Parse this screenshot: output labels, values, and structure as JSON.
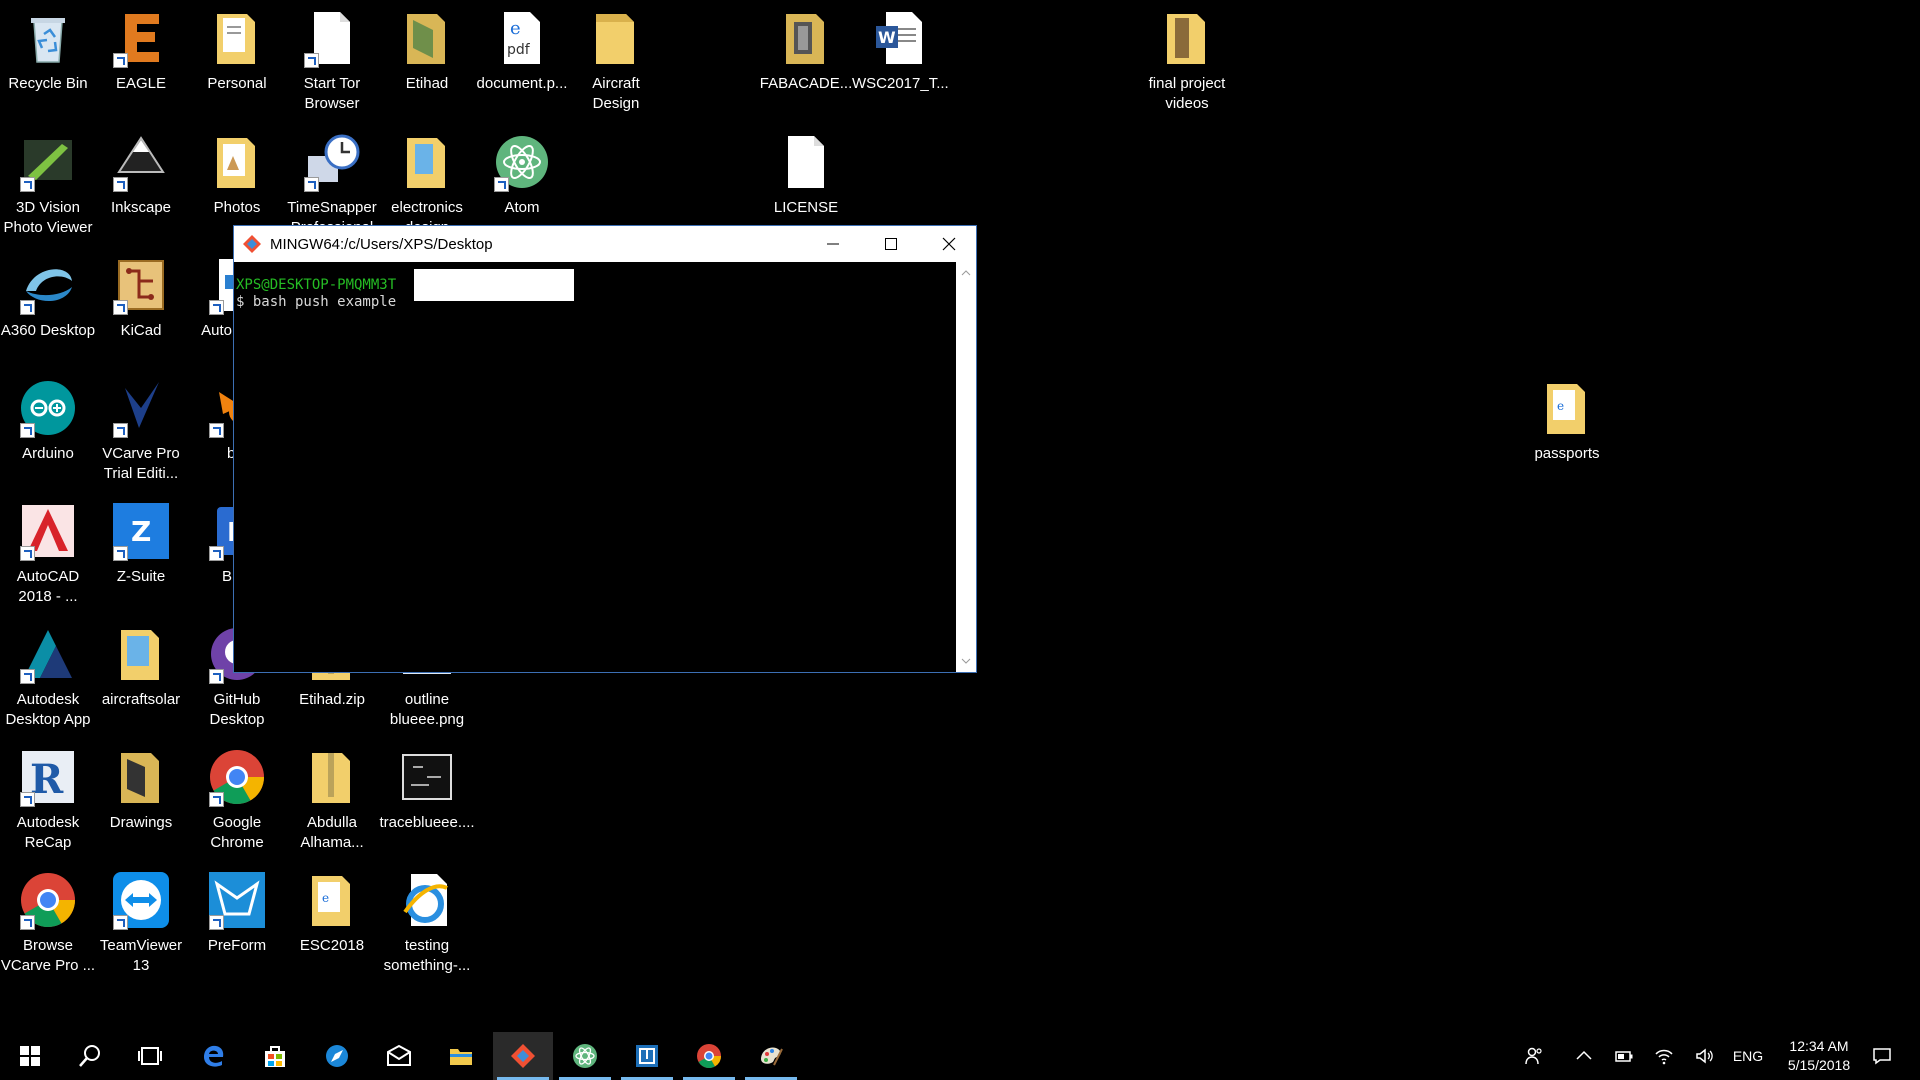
{
  "desktop": {
    "icons": [
      {
        "label": "Recycle Bin",
        "icon": "recycle-bin-icon"
      },
      {
        "label": "EAGLE",
        "icon": "eagle-icon"
      },
      {
        "label": "Personal",
        "icon": "folder-icon"
      },
      {
        "label": "Start Tor Browser",
        "icon": "file-icon"
      },
      {
        "label": "Etihad",
        "icon": "folder-icon"
      },
      {
        "label": "document.p...",
        "icon": "pdf-icon"
      },
      {
        "label": "Aircraft Design",
        "icon": "folder-icon"
      },
      {
        "label": "FABACADE...",
        "icon": "folder-icon"
      },
      {
        "label": "WSC2017_T...",
        "icon": "word-doc-icon"
      },
      {
        "label": "final project videos",
        "icon": "folder-icon"
      },
      {
        "label": "3D Vision Photo Viewer",
        "icon": "3d-vision-icon"
      },
      {
        "label": "Inkscape",
        "icon": "inkscape-icon"
      },
      {
        "label": "Photos",
        "icon": "folder-icon"
      },
      {
        "label": "TimeSnapper Professional",
        "icon": "timesnapper-icon"
      },
      {
        "label": "electronics design",
        "icon": "folder-icon"
      },
      {
        "label": "Atom",
        "icon": "atom-icon"
      },
      {
        "label": "LICENSE",
        "icon": "file-icon"
      },
      {
        "label": "A360 Desktop",
        "icon": "a360-icon"
      },
      {
        "label": "KiCad",
        "icon": "kicad-icon"
      },
      {
        "label": "Auto Fusio",
        "icon": "fusion-icon"
      },
      {
        "label": "Arduino",
        "icon": "arduino-icon"
      },
      {
        "label": "VCarve Pro Trial Editi...",
        "icon": "vcarve-icon"
      },
      {
        "label": "ble",
        "icon": "blender-icon"
      },
      {
        "label": "passports",
        "icon": "folder-icon"
      },
      {
        "label": "AutoCAD 2018 - ...",
        "icon": "autocad-icon"
      },
      {
        "label": "Z-Suite",
        "icon": "zsuite-icon"
      },
      {
        "label": "Blue",
        "icon": "bluestacks-icon"
      },
      {
        "label": "Autodesk Desktop App",
        "icon": "autodesk-app-icon"
      },
      {
        "label": "aircraftsolar",
        "icon": "folder-icon"
      },
      {
        "label": "GitHub Desktop",
        "icon": "github-icon"
      },
      {
        "label": "Etihad.zip",
        "icon": "zip-folder-icon"
      },
      {
        "label": "outline blueee.png",
        "icon": "image-icon"
      },
      {
        "label": "Autodesk ReCap",
        "icon": "recap-icon"
      },
      {
        "label": "Drawings",
        "icon": "folder-icon"
      },
      {
        "label": "Google Chrome",
        "icon": "chrome-icon"
      },
      {
        "label": "Abdulla Alhama...",
        "icon": "zip-folder-icon"
      },
      {
        "label": "traceblueee....",
        "icon": "image-icon"
      },
      {
        "label": "Browse VCarve Pro ...",
        "icon": "chrome-icon"
      },
      {
        "label": "TeamViewer 13",
        "icon": "teamviewer-icon"
      },
      {
        "label": "PreForm",
        "icon": "preform-icon"
      },
      {
        "label": "ESC2018",
        "icon": "folder-icon"
      },
      {
        "label": "testing something-...",
        "icon": "ie-file-icon"
      }
    ]
  },
  "terminal": {
    "title": "MINGW64:/c/Users/XPS/Desktop",
    "prompt": "XPS@DESKTOP-PMQMM3T",
    "command": "$ bash push example"
  },
  "taskbar": {
    "apps": [
      {
        "name": "start-button",
        "icon": "windows-logo-icon"
      },
      {
        "name": "search-button",
        "icon": "search-icon"
      },
      {
        "name": "task-view-button",
        "icon": "task-view-icon"
      },
      {
        "name": "taskbar-edge",
        "icon": "edge-icon"
      },
      {
        "name": "taskbar-store",
        "icon": "store-icon"
      },
      {
        "name": "taskbar-app-blue",
        "icon": "compass-icon"
      },
      {
        "name": "taskbar-mail",
        "icon": "mail-icon"
      },
      {
        "name": "taskbar-file-explorer",
        "icon": "folder-icon"
      },
      {
        "name": "taskbar-git-bash",
        "icon": "git-icon"
      },
      {
        "name": "taskbar-atom",
        "icon": "atom-icon"
      },
      {
        "name": "taskbar-app-box",
        "icon": "box-app-icon"
      },
      {
        "name": "taskbar-chrome",
        "icon": "chrome-icon"
      },
      {
        "name": "taskbar-paint",
        "icon": "paint-icon"
      }
    ],
    "language": "ENG",
    "time": "12:34 AM",
    "date": "5/15/2018"
  },
  "colors": {
    "prompt_green": "#25bc24",
    "window_border": "#3c6fb4",
    "accent": "#76b9ed"
  }
}
